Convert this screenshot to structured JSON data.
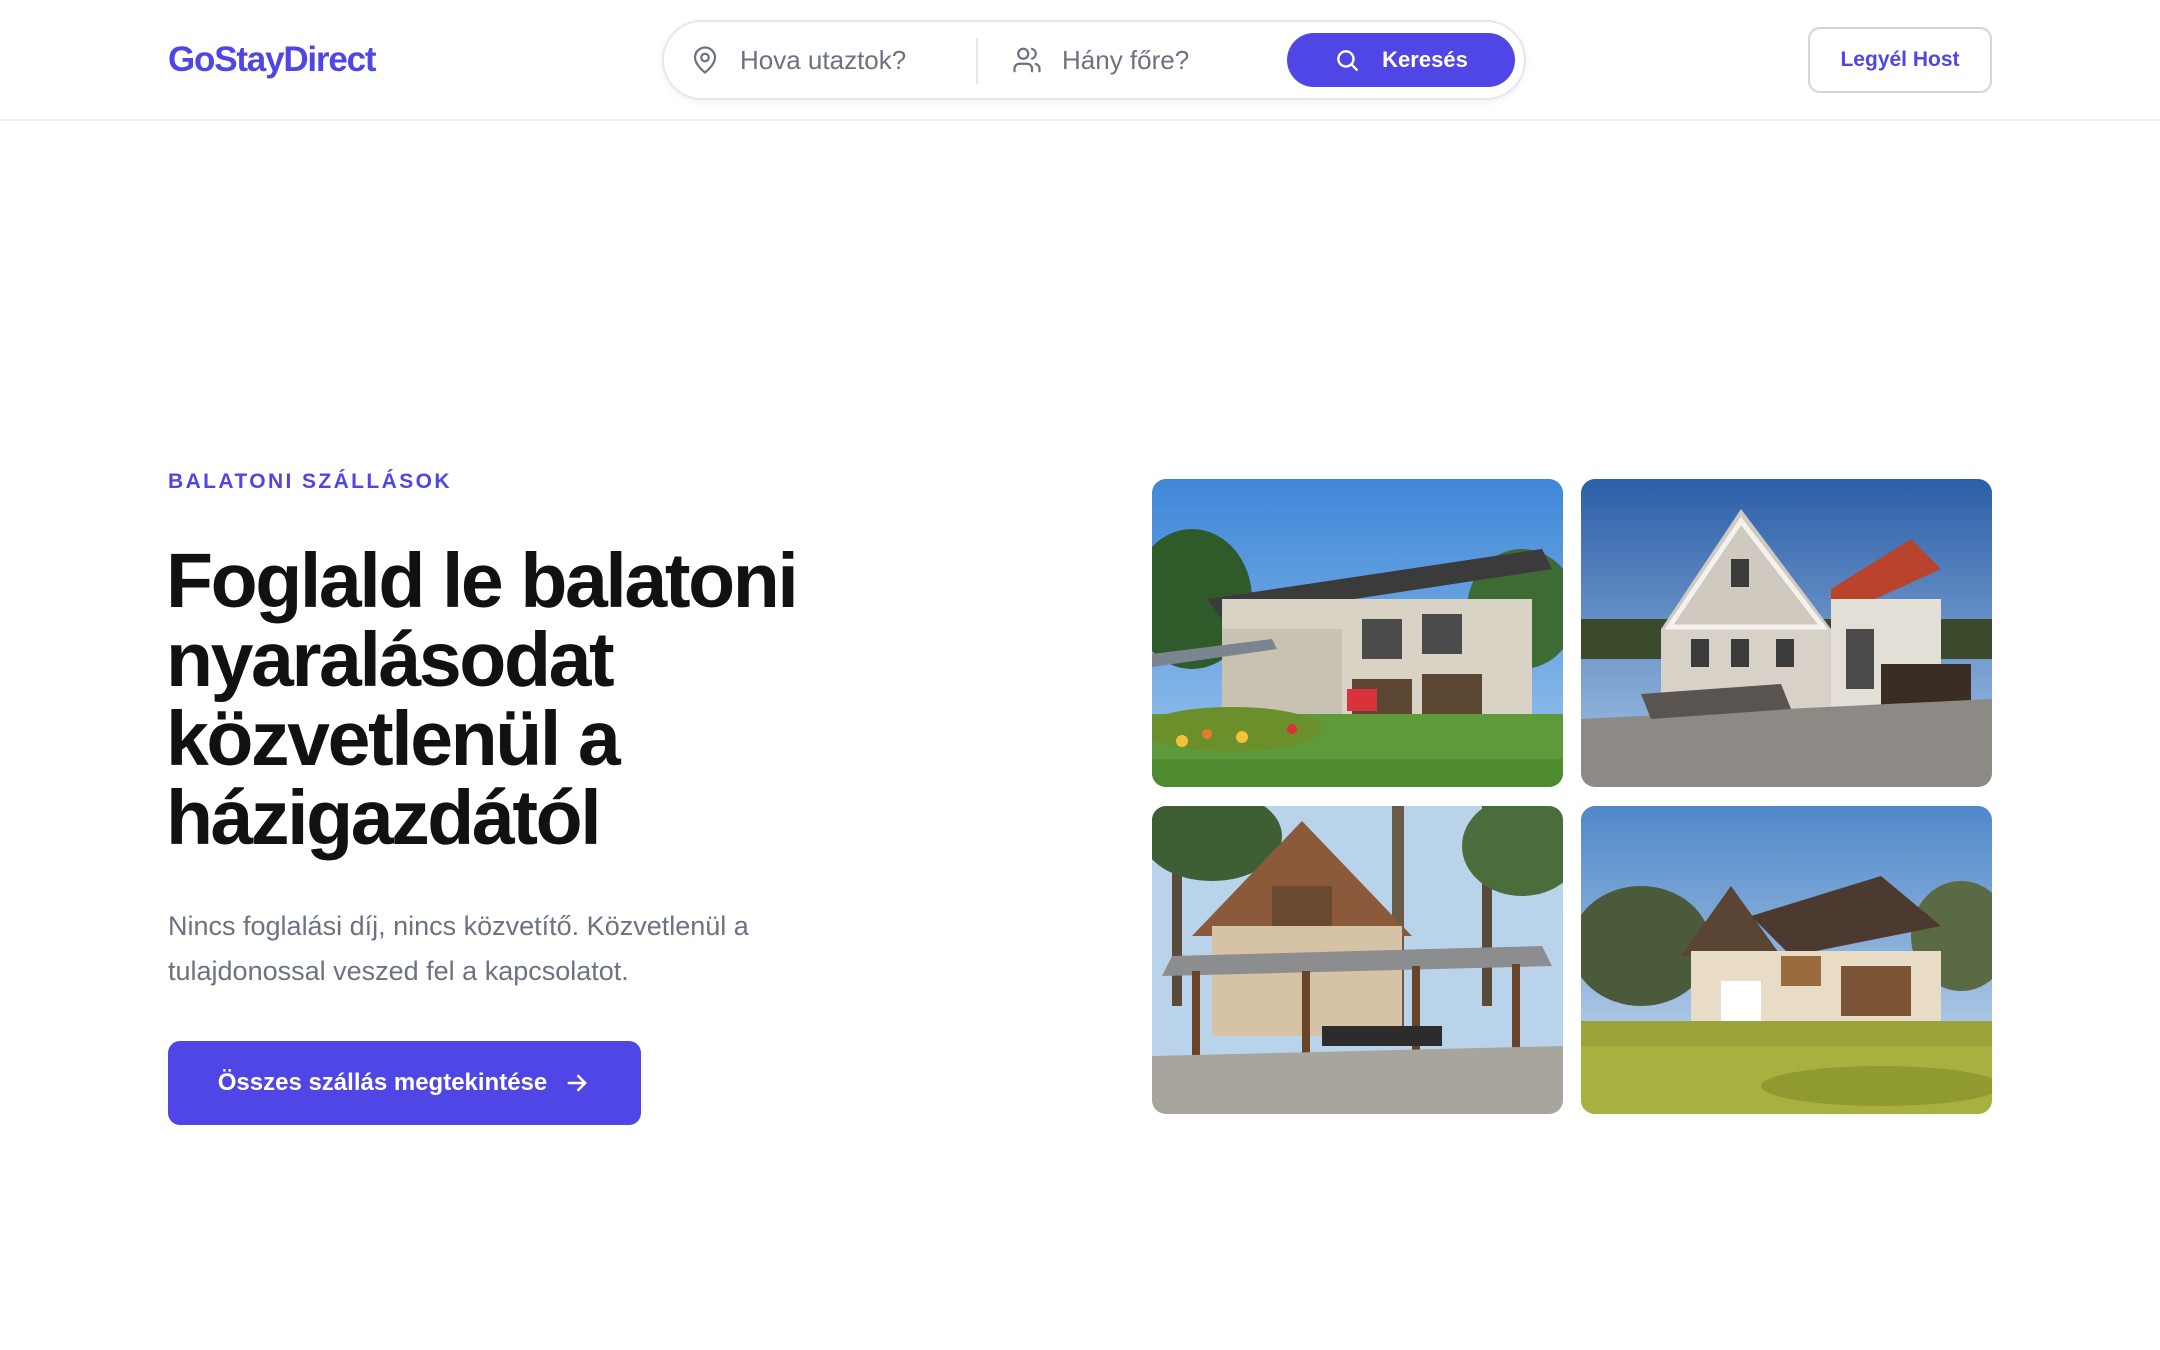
{
  "header": {
    "logo": "GoStayDirect",
    "search": {
      "where_placeholder": "Hova utaztok?",
      "guests_placeholder": "Hány főre?",
      "button_label": "Keresés"
    },
    "host_button": "Legyél Host"
  },
  "hero": {
    "eyebrow": "BALATONI SZÁLLÁSOK",
    "title": "Foglald le balatoni nyaralásodat közvetlenül a házigazdától",
    "subtitle": "Nincs foglalási díj, nincs közvetítő. Közvetlenül a tulajdonossal veszed fel a kapcsolatot.",
    "cta": "Összes szállás megtekintése"
  },
  "icons": {
    "location": "map-pin-icon",
    "guests": "users-icon",
    "search": "search-icon",
    "cta": "arrow-right-icon"
  },
  "colors": {
    "brand": "#4f46e5",
    "text": "#111111",
    "muted": "#6b7280",
    "border": "#e5e7eb"
  }
}
